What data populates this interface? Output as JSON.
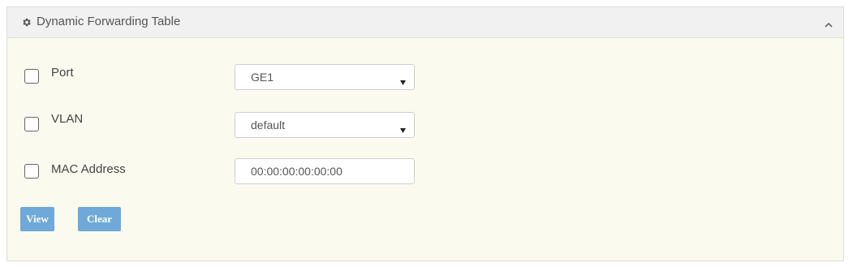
{
  "panel": {
    "title": "Dynamic Forwarding Table",
    "header_icon": "gear-icon",
    "collapse_icon": "chevron-up-icon"
  },
  "filters": {
    "port": {
      "label": "Port",
      "checked": false,
      "selected": "GE1"
    },
    "vlan": {
      "label": "VLAN",
      "checked": false,
      "selected": "default"
    },
    "mac": {
      "label": "MAC Address",
      "checked": false,
      "value": "00:00:00:00:00:00"
    }
  },
  "buttons": {
    "view_label": "View",
    "clear_label": "Clear"
  },
  "colors": {
    "panel_background": "#fbfaee",
    "header_background": "#f1f1f1",
    "button_background": "#6fa9d9"
  }
}
